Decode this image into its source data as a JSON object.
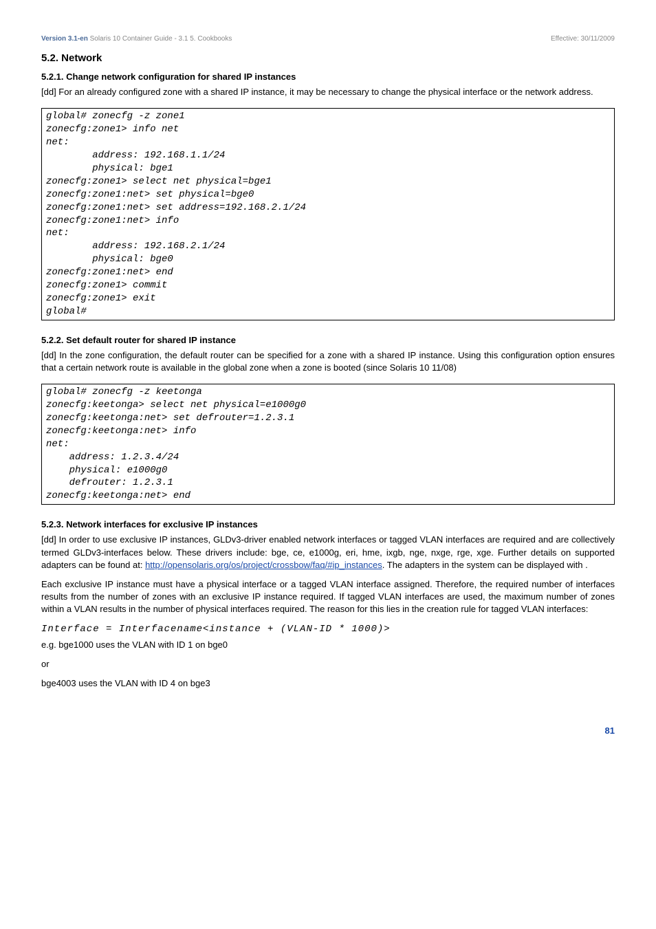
{
  "header": {
    "version": "Version 3.1-en",
    "title": "  Solaris 10 Container Guide - 3.1   5. Cookbooks",
    "effective": "Effective: 30/11/2009"
  },
  "s52": {
    "heading": "5.2. Network",
    "s521": {
      "heading": "5.2.1. Change network configuration for shared IP instances",
      "para": "[dd] For an already configured zone with a shared IP instance, it may be necessary to change the physical interface or the network address.",
      "code": "global# zonecfg -z zone1\nzonecfg:zone1> info net\nnet:\n        address: 192.168.1.1/24\n        physical: bge1\nzonecfg:zone1> select net physical=bge1\nzonecfg:zone1:net> set physical=bge0\nzonecfg:zone1:net> set address=192.168.2.1/24\nzonecfg:zone1:net> info\nnet:\n        address: 192.168.2.1/24\n        physical: bge0\nzonecfg:zone1:net> end\nzonecfg:zone1> commit\nzonecfg:zone1> exit\nglobal#"
    },
    "s522": {
      "heading": "5.2.2. Set default router for shared IP instance",
      "para": "[dd] In the zone configuration, the default router can be specified for a zone with a shared IP instance. Using this configuration option ensures that a certain network route is available in the global zone when a zone is booted (since Solaris 10 11/08)",
      "code": "global# zonecfg -z keetonga\nzonecfg:keetonga> select net physical=e1000g0\nzonecfg:keetonga:net> set defrouter=1.2.3.1\nzonecfg:keetonga:net> info\nnet:\n    address: 1.2.3.4/24\n    physical: e1000g0\n    defrouter: 1.2.3.1\nzonecfg:keetonga:net> end"
    },
    "s523": {
      "heading": "5.2.3. Network interfaces for exclusive IP instances",
      "para1a": "[dd] In order to use exclusive IP instances, GLDv3-driver enabled network interfaces or tagged VLAN interfaces are required and are collectively termed GLDv3-interfaces below. These drivers include: bge, ce, e1000g, eri, hme, ixgb, nge, nxge, rge, xge. Further details on supported adapters can be found at: ",
      "link": "http://opensolaris.org/os/project/crossbow/faq/#ip_instances",
      "para1b": ". The adapters in the system can be displayed with                                    .",
      "para2": "Each exclusive IP instance must have a physical interface or a tagged VLAN interface assigned. Therefore, the required number of interfaces results from the number of zones with an exclusive IP instance required. If tagged VLAN interfaces are used, the maximum number of zones within a VLAN results in the number of physical interfaces required. The reason for this lies in the creation rule for tagged VLAN interfaces:",
      "formula": "Interface = Interfacename<instance + (VLAN-ID * 1000)>",
      "eg1": "e.g. bge1000 uses the VLAN with ID 1 on bge0",
      "or": "or",
      "eg2": "bge4003 uses the VLAN with ID 4 on bge3"
    }
  },
  "pagenum": "81"
}
